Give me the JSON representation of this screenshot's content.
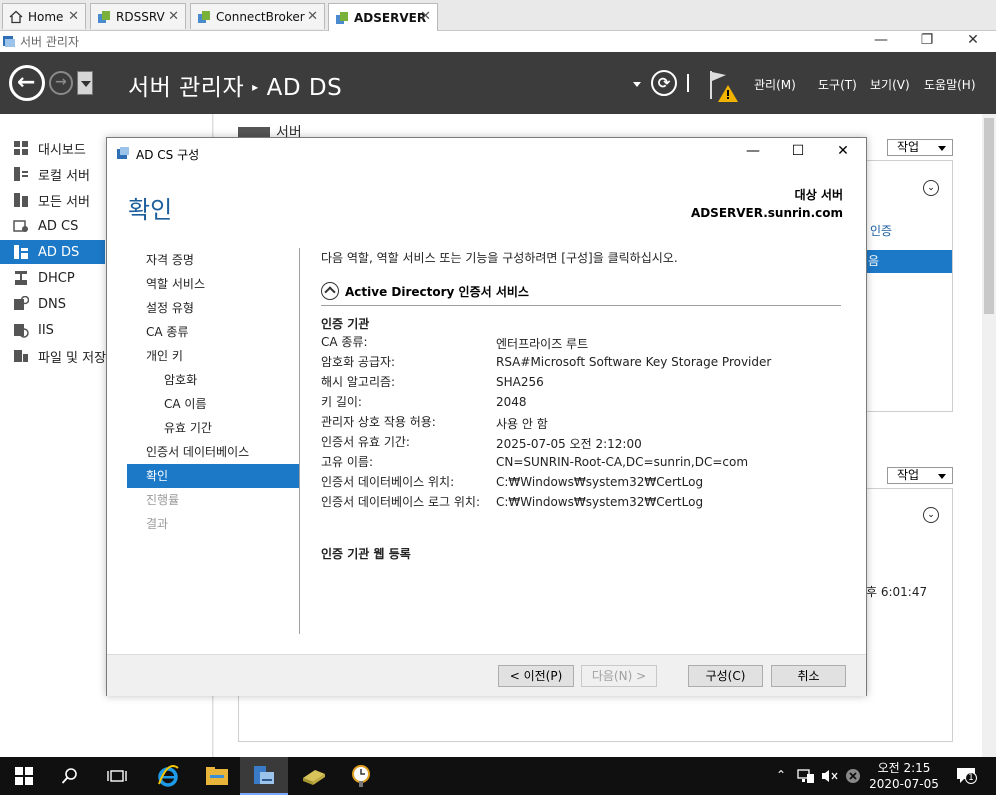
{
  "tabs": [
    {
      "label": "Home",
      "icon": "home-icon"
    },
    {
      "label": "RDSSRV",
      "icon": "server-icon"
    },
    {
      "label": "ConnectBroker",
      "icon": "server-icon"
    },
    {
      "label": "ADSERVER",
      "icon": "server-icon",
      "active": true
    }
  ],
  "window": {
    "title": "서버 관리자",
    "minimize": "—",
    "restore": "❐",
    "close": "✕"
  },
  "header": {
    "breadcrumb_root": "서버 관리자",
    "breadcrumb_sep": "▸",
    "breadcrumb_current": "AD DS",
    "menus": [
      "관리(M)",
      "도구(T)",
      "보기(V)",
      "도움말(H)"
    ]
  },
  "sidebar": {
    "items": [
      {
        "label": "대시보드",
        "icon": "dashboard-icon"
      },
      {
        "label": "로컬 서버",
        "icon": "local-server-icon"
      },
      {
        "label": "모든 서버",
        "icon": "all-servers-icon"
      },
      {
        "label": "AD CS",
        "icon": "ad-cs-icon"
      },
      {
        "label": "AD DS",
        "icon": "ad-ds-icon",
        "selected": true
      },
      {
        "label": "DHCP",
        "icon": "dhcp-icon"
      },
      {
        "label": "DNS",
        "icon": "dns-icon"
      },
      {
        "label": "IIS",
        "icon": "iis-icon"
      },
      {
        "label": "파일 및 저장",
        "icon": "file-storage-icon"
      }
    ]
  },
  "background": {
    "section_title": "서버",
    "task_label": "작업",
    "column_partial": "인증",
    "row_partial": "음",
    "time_partial": "후 6:01:47"
  },
  "dialog": {
    "title": "AD CS 구성",
    "heading": "확인",
    "target_label": "대상 서버",
    "target_value": "ADSERVER.sunrin.com",
    "steps": [
      {
        "label": "자격 증명",
        "level": 0
      },
      {
        "label": "역할 서비스",
        "level": 0
      },
      {
        "label": "설정 유형",
        "level": 0
      },
      {
        "label": "CA 종류",
        "level": 0
      },
      {
        "label": "개인 키",
        "level": 0
      },
      {
        "label": "암호화",
        "level": 1
      },
      {
        "label": "CA 이름",
        "level": 1
      },
      {
        "label": "유효 기간",
        "level": 1
      },
      {
        "label": "인증서 데이터베이스",
        "level": 0
      },
      {
        "label": "확인",
        "level": 0,
        "active": true
      },
      {
        "label": "진행률",
        "level": 0,
        "disabled": true
      },
      {
        "label": "결과",
        "level": 0,
        "disabled": true
      }
    ],
    "intro": "다음 역할, 역할 서비스 또는 기능을 구성하려면 [구성]을 클릭하십시오.",
    "section": "Active Directory 인증서 서비스",
    "subsection1": "인증 기관",
    "properties": [
      {
        "key": "CA 종류:",
        "value": "엔터프라이즈 루트"
      },
      {
        "key": "암호화 공급자:",
        "value": "RSA#Microsoft Software Key Storage Provider"
      },
      {
        "key": "해시 알고리즘:",
        "value": "SHA256"
      },
      {
        "key": "키 길이:",
        "value": "2048"
      },
      {
        "key": "관리자 상호 작용 허용:",
        "value": "사용 안 함"
      },
      {
        "key": "인증서 유효 기간:",
        "value": "2025-07-05 오전 2:12:00"
      },
      {
        "key": "고유 이름:",
        "value": "CN=SUNRIN-Root-CA,DC=sunrin,DC=com"
      },
      {
        "key": "인증서 데이터베이스 위치:",
        "value": "C:₩Windows₩system32₩CertLog"
      },
      {
        "key": "인증서 데이터베이스 로그 위치:",
        "value": "C:₩Windows₩system32₩CertLog"
      }
    ],
    "subsection2": "인증 기관 웹 등록",
    "buttons": {
      "prev": "< 이전(P)",
      "next": "다음(N) >",
      "configure": "구성(C)",
      "cancel": "취소"
    }
  },
  "taskbar": {
    "time": "오전 2:15",
    "date": "2020-07-05",
    "notification_count": "1"
  }
}
